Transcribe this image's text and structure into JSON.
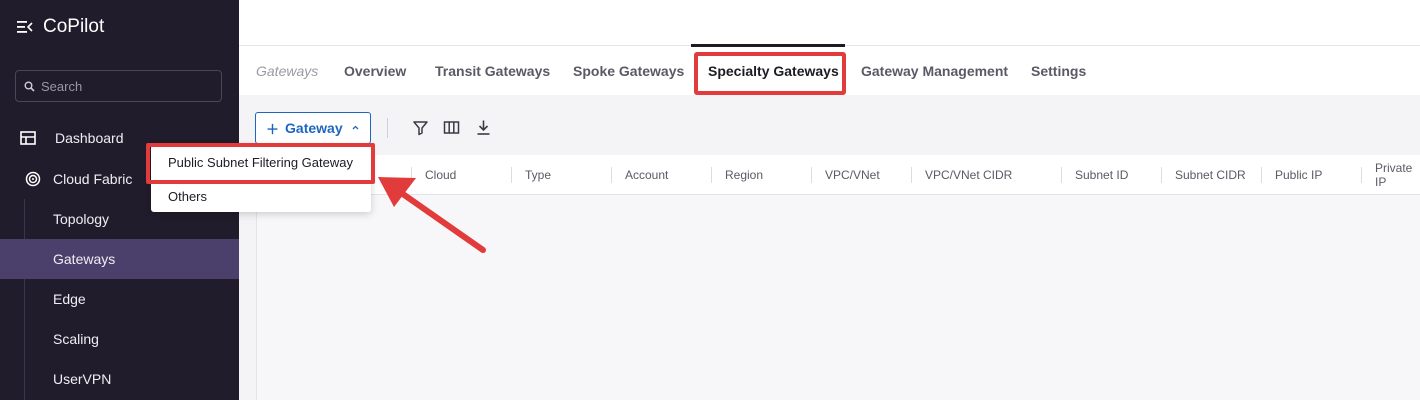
{
  "app": {
    "title": "CoPilot"
  },
  "search": {
    "placeholder": "Search",
    "value": ""
  },
  "sidebar": {
    "items": [
      {
        "label": "Dashboard",
        "icon": "dashboard-icon"
      },
      {
        "label": "Cloud Fabric",
        "icon": "cloud-fabric-icon"
      }
    ],
    "sub_items": [
      {
        "label": "Topology"
      },
      {
        "label": "Gateways",
        "active": true
      },
      {
        "label": "Edge"
      },
      {
        "label": "Scaling"
      },
      {
        "label": "UserVPN"
      }
    ]
  },
  "tabs": {
    "crumb": "Gateways",
    "items": [
      "Overview",
      "Transit Gateways",
      "Spoke Gateways",
      "Specialty Gateways",
      "Gateway Management",
      "Settings"
    ],
    "active": "Specialty Gateways"
  },
  "toolbar": {
    "gateway_button": "Gateway",
    "icons": [
      "filter-icon",
      "columns-icon",
      "download-icon"
    ]
  },
  "dropdown": {
    "items": [
      "Public Subnet Filtering Gateway",
      "Others"
    ]
  },
  "table": {
    "columns": [
      "Cloud",
      "Type",
      "Account",
      "Region",
      "VPC/VNet",
      "VPC/VNet CIDR",
      "Subnet ID",
      "Subnet CIDR",
      "Public IP",
      "Private IP"
    ]
  },
  "colors": {
    "sidebar_bg": "#201c2b",
    "active_nav": "#4b3f6b",
    "accent": "#1f66c1",
    "annotation": "#e23b3b"
  }
}
